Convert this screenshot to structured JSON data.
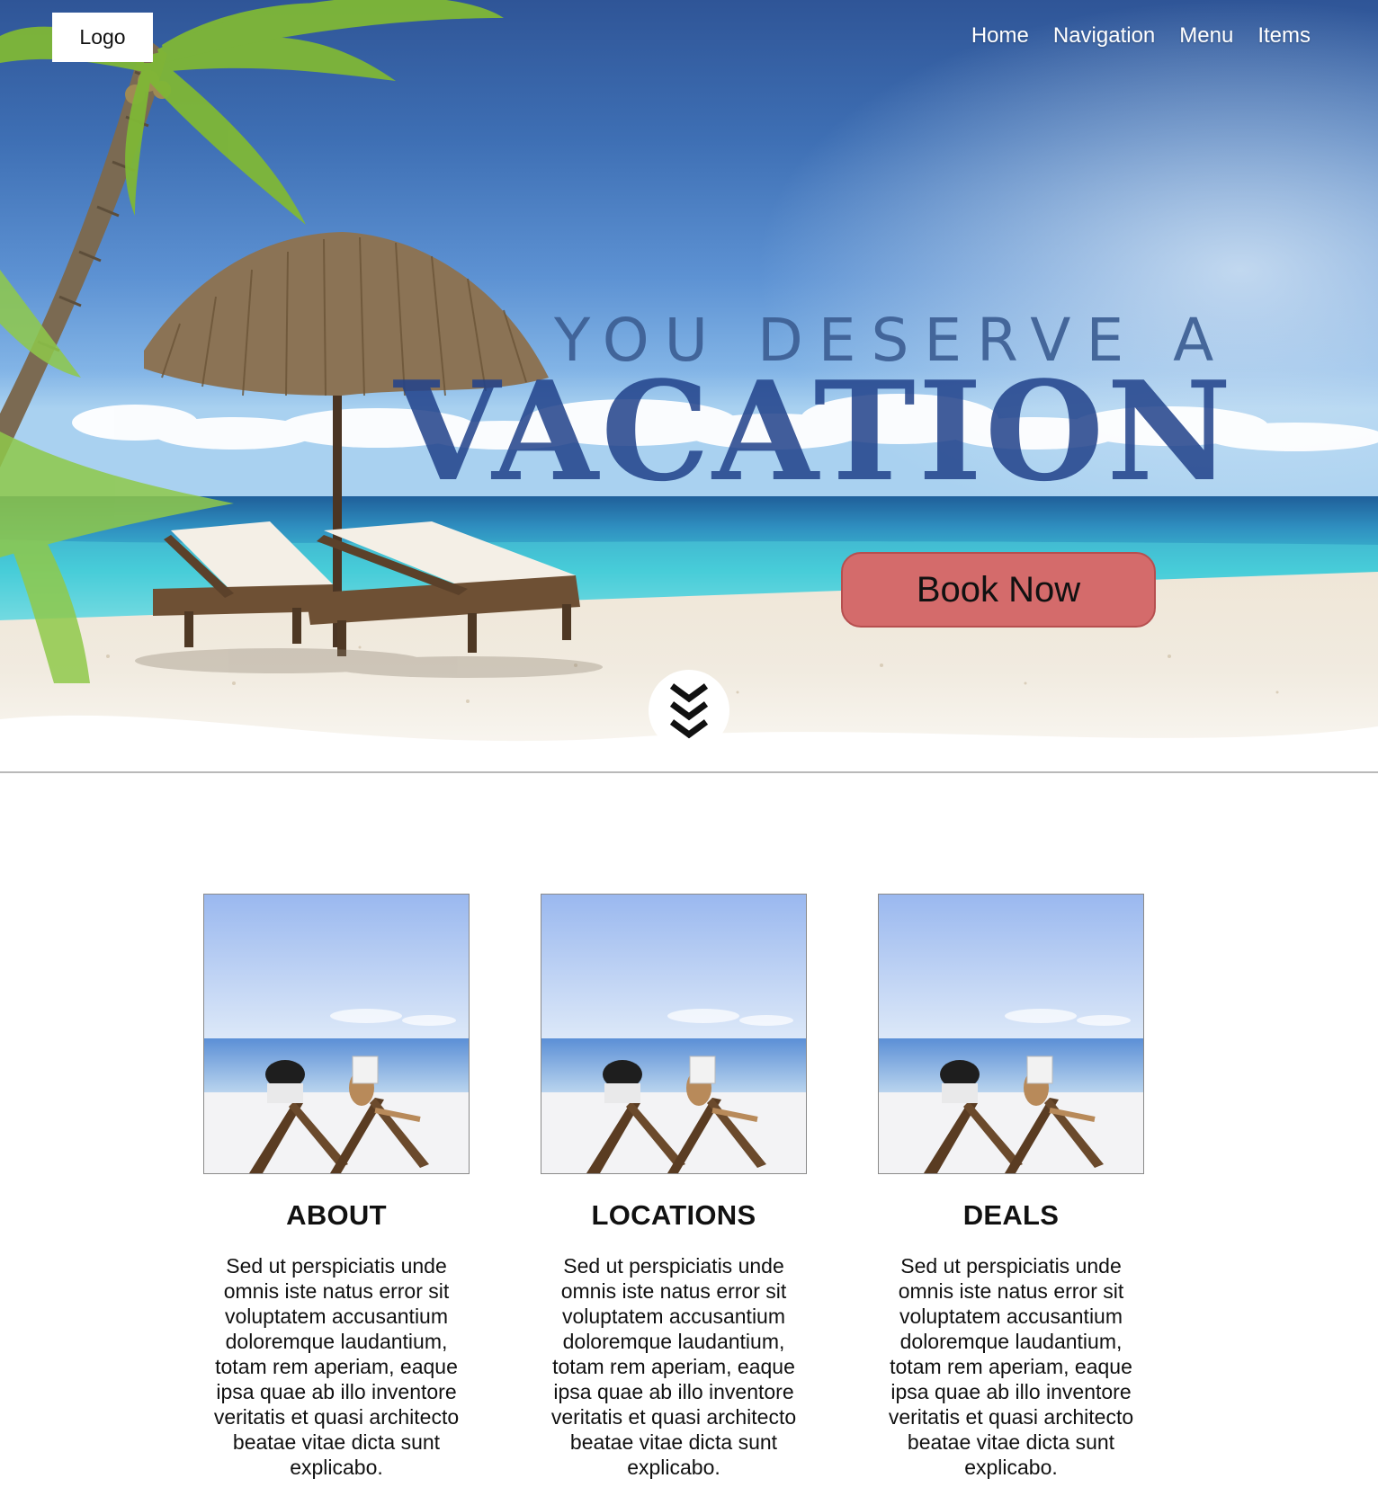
{
  "header": {
    "logo": "Logo",
    "nav": [
      "Home",
      "Navigation",
      "Menu",
      "Items"
    ]
  },
  "hero": {
    "tagline_small": "YOU DESERVE A",
    "tagline_big": "VACATION",
    "cta_label": "Book Now",
    "scroll_icon": "chevron-double-down-icon"
  },
  "cards": [
    {
      "title": "ABOUT",
      "text": "Sed ut perspiciatis unde omnis iste natus error sit voluptatem accusantium doloremque laudantium, totam rem aperiam, eaque ipsa quae ab illo inventore veritatis et quasi architecto beatae vitae dicta sunt explicabo."
    },
    {
      "title": "LOCATIONS",
      "text": "Sed ut perspiciatis unde omnis iste natus error sit voluptatem accusantium doloremque laudantium, totam rem aperiam, eaque ipsa quae ab illo inventore veritatis et quasi architecto beatae vitae dicta sunt explicabo."
    },
    {
      "title": "DEALS",
      "text": "Sed ut perspiciatis unde omnis iste natus error sit voluptatem accusantium doloremque laudantium, totam rem aperiam, eaque ipsa quae ab illo inventore veritatis et quasi architecto beatae vitae dicta sunt explicabo."
    }
  ],
  "colors": {
    "cta": "#d46b6b",
    "sky": "#3e6fb4",
    "tagline": "#22428a",
    "sea": "#3fc9d6"
  }
}
